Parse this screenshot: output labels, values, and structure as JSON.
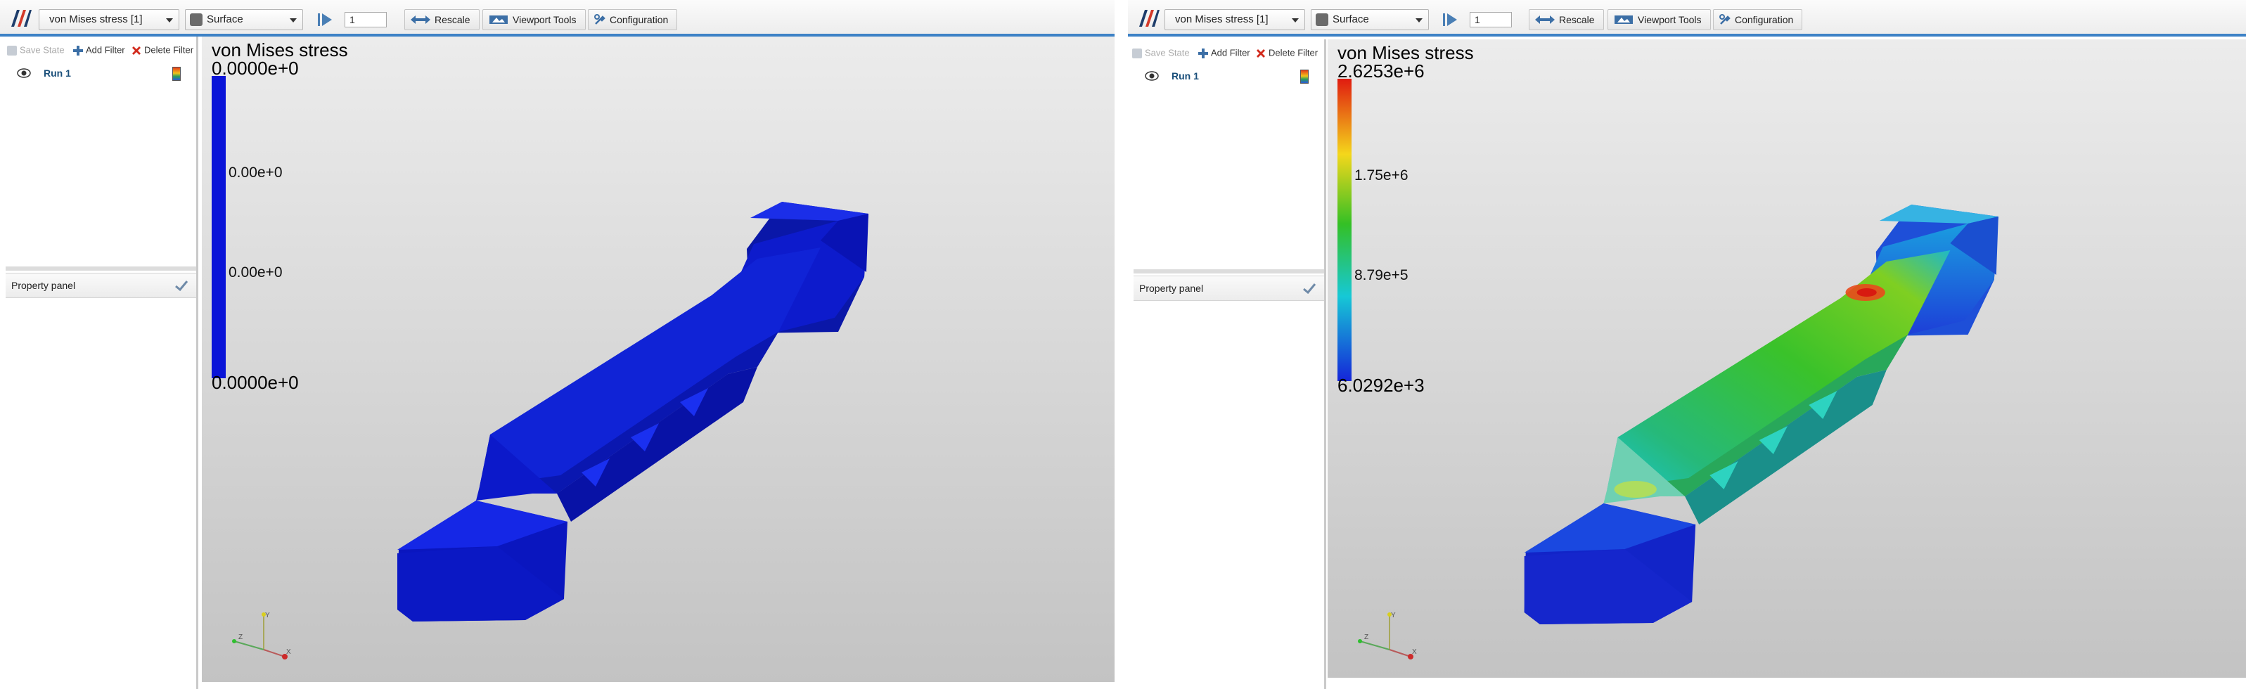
{
  "panels": [
    {
      "toolbar": {
        "field": "von Mises stress [1]",
        "representation": "Surface",
        "frame": "1",
        "rescale": "Rescale",
        "viewport_tools": "Viewport Tools",
        "configuration": "Configuration"
      },
      "filters": {
        "save_state": "Save State",
        "add_filter": "Add Filter",
        "delete_filter": "Delete Filter"
      },
      "pipeline": {
        "run": "Run 1"
      },
      "property_panel": "Property panel",
      "scalar_bar": {
        "title": "von Mises stress",
        "max": "0.0000e+0",
        "tick_high": "0.00e+0",
        "tick_low": "0.00e+0",
        "min": "0.0000e+0"
      },
      "axes": {
        "y": "Y",
        "z": "Z",
        "x": "X"
      }
    },
    {
      "toolbar": {
        "field": "von Mises stress [1]",
        "representation": "Surface",
        "frame": "1",
        "rescale": "Rescale",
        "viewport_tools": "Viewport Tools",
        "configuration": "Configuration"
      },
      "filters": {
        "save_state": "Save State",
        "add_filter": "Add Filter",
        "delete_filter": "Delete Filter"
      },
      "pipeline": {
        "run": "Run 1"
      },
      "property_panel": "Property panel",
      "scalar_bar": {
        "title": "von Mises stress",
        "max": "2.6253e+6",
        "tick_high": "1.75e+6",
        "tick_low": "8.79e+5",
        "min": "6.0292e+3"
      },
      "axes": {
        "y": "Y",
        "z": "Z",
        "x": "X"
      }
    }
  ],
  "colors": {
    "accent": "#3d82c6",
    "uniform_blue": "#0a14d8",
    "colormap": [
      "#e01b10",
      "#f4d71b",
      "#34c025",
      "#16c8d6",
      "#1525d9"
    ]
  },
  "icons": [
    "app-logo-icon",
    "representation-icon",
    "play-icon",
    "rescale-icon",
    "viewport-tools-icon",
    "configuration-icon",
    "save-state-icon",
    "add-filter-icon",
    "delete-filter-icon",
    "eye-icon",
    "colormap-icon",
    "checkmark-icon",
    "axes-triad-icon"
  ]
}
